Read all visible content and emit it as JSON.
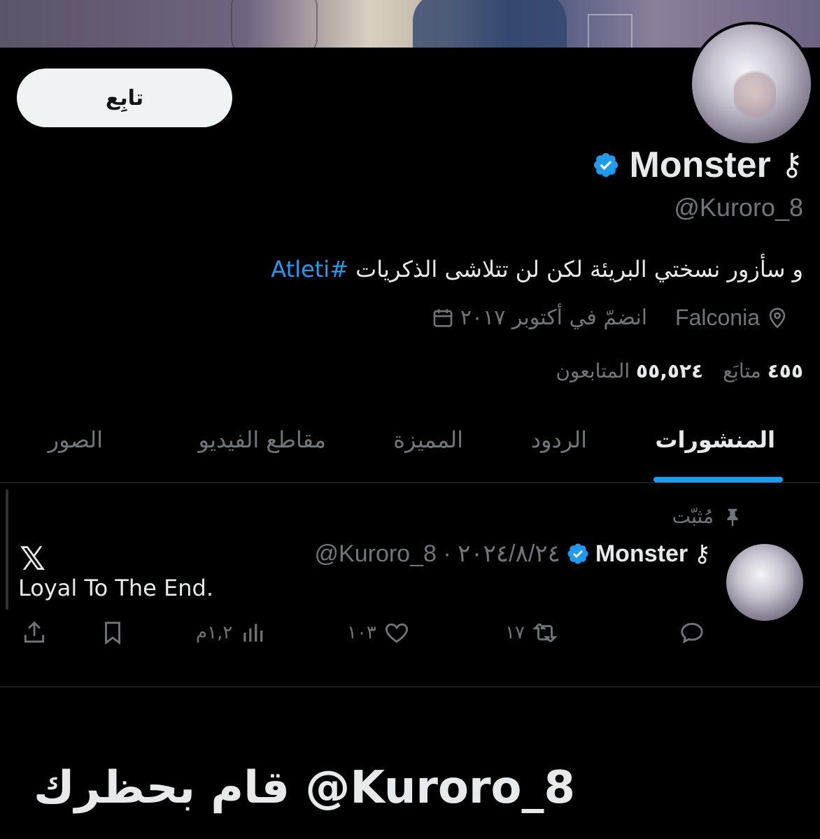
{
  "profile": {
    "follow_label": "تابِع",
    "display_name": "Monster",
    "name_glyph": "⚷",
    "handle": "@Kuroro_8",
    "bio_text": "و سأزور نسختي البريئة لكن لن تتلاشى الذكريات ",
    "bio_hashtag": "#Atleti",
    "location": "Falconia",
    "joined": "انضمّ في أكتوبر ٢٠١٧",
    "following_count": "٤٥٥",
    "following_label": "متابَع",
    "followers_count": "٥٥,٥٢٤",
    "followers_label": "المتابعون"
  },
  "tabs": [
    {
      "label": "المنشورات",
      "active": true
    },
    {
      "label": "الردود"
    },
    {
      "label": "المميزة"
    },
    {
      "label": "مقاطع الفيديو"
    },
    {
      "label": "الصور"
    }
  ],
  "pinned_tweet": {
    "pinned_label": "مُثبّت",
    "name": "Monster",
    "handle_date": "@Kuroro_8 · ٢٠٢٤/٨/٢٤",
    "logo": "𝕏",
    "text": "Loyal To The End.",
    "retweets": "١٧",
    "likes": "١٠٣",
    "views": "١,٢م"
  },
  "caption": "قام بحظرك @Kuroro_8",
  "colors": {
    "accent": "#1d9bf0",
    "secondary_text": "#71767b",
    "background": "#000000"
  },
  "icons": [
    "verified-badge-icon",
    "location-pin-icon",
    "calendar-icon",
    "pin-icon",
    "reply-icon",
    "retweet-icon",
    "like-icon",
    "views-icon",
    "bookmark-icon",
    "share-icon",
    "x-logo-icon"
  ]
}
